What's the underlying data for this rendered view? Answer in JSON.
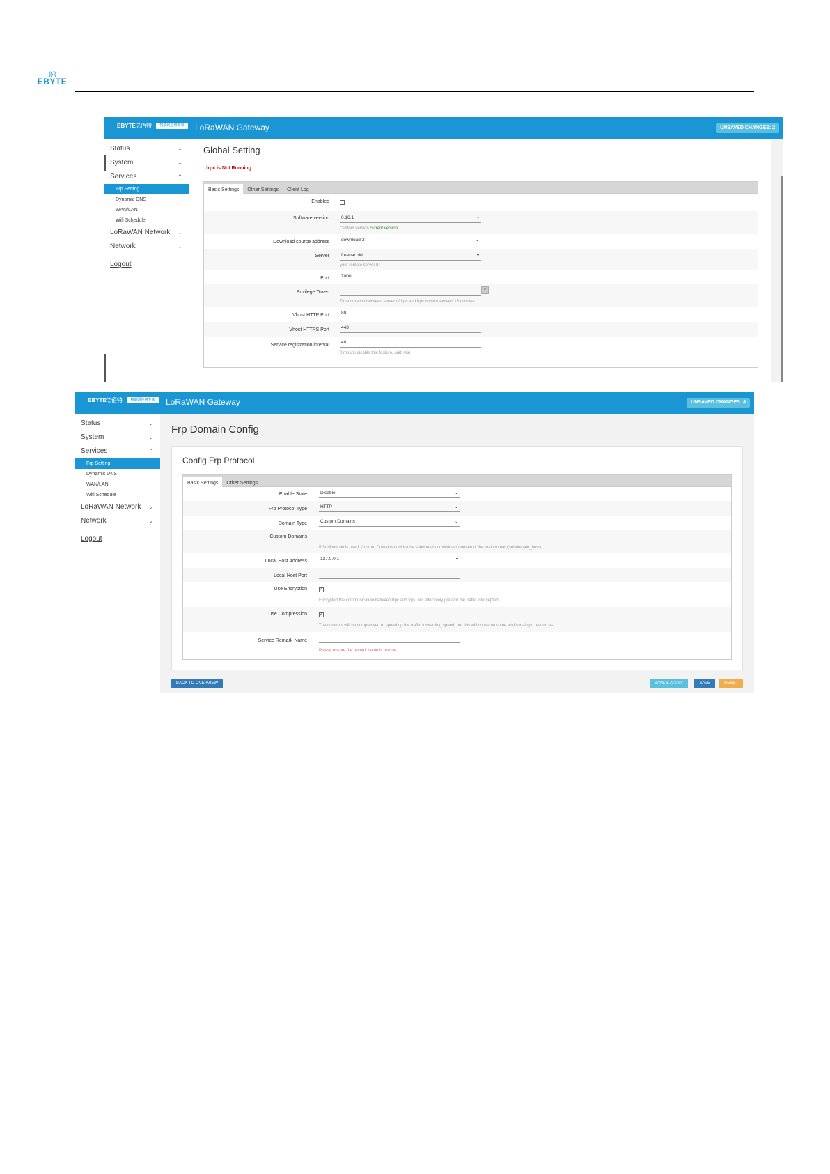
{
  "doc": {
    "logo_text": "EBYTE"
  },
  "shot1": {
    "brand": {
      "logo_text": "EBYTE",
      "logo_cn": "亿佰特",
      "logo_tag": "物联网应用专家"
    },
    "app_title": "LoRaWAN Gateway",
    "unsaved": "UNSAVED CHANGES: 2",
    "nav": {
      "status": "Status",
      "system": "System",
      "services": "Services",
      "lorawan": "LoRaWAN Network",
      "network": "Network",
      "logout": "Logout"
    },
    "subnav": [
      "Frp Setting",
      "Dynamic DNS",
      "WAN/LAN",
      "Wifi Schedule"
    ],
    "page_title": "Global Setting",
    "status_text": "frpc is Not Running",
    "tabs": [
      "Basic Settings",
      "Other Settings",
      "Client Log"
    ],
    "form": {
      "enabled_label": "Enabled",
      "software_version_label": "Software version",
      "software_version_value": "0.16.1",
      "software_version_hint": "Custom version.",
      "software_version_hint_green": "current version:",
      "download_label": "Download source address",
      "download_value": "download-2",
      "server_label": "Server",
      "server_value": "freenat.bid",
      "server_hint": "your remote server IP",
      "port_label": "Port",
      "port_value": "7000",
      "token_label": "Privilege Token",
      "token_value": "········",
      "token_hint": "Time duration between server of frpc and frps mustn't exceed 15 minutes.",
      "vhost_http_label": "Vhost HTTP Port",
      "vhost_http_value": "80",
      "vhost_https_label": "Vhost HTTPS Port",
      "vhost_https_value": "443",
      "reg_label": "Service registration interval",
      "reg_value": "40",
      "reg_hint": "0 means disable this feature, unit: min"
    }
  },
  "shot2": {
    "brand": {
      "logo_text": "EBYTE",
      "logo_cn": "亿佰特",
      "logo_tag": "物联网应用专家"
    },
    "app_title": "LoRaWAN Gateway",
    "unsaved": "UNSAVED CHANGES: 4",
    "nav": {
      "status": "Status",
      "system": "System",
      "services": "Services",
      "lorawan": "LoRaWAN Network",
      "network": "Network",
      "logout": "Logout"
    },
    "subnav": [
      "Frp Setting",
      "Dynamic DNS",
      "WAN/LAN",
      "Wifi Schedule"
    ],
    "page_title": "Frp Domain Config",
    "section_title": "Config Frp Protocol",
    "tabs": [
      "Basic Settings",
      "Other Settings"
    ],
    "form": {
      "enable_state_label": "Enable State",
      "enable_state_value": "Disable",
      "protocol_label": "Frp Protocol Type",
      "protocol_value": "HTTP",
      "domain_type_label": "Domain Type",
      "domain_type_value": "Custom Domains",
      "custom_domains_label": "Custom Domains",
      "custom_domains_hint": "If SubDomain is used, Custom Domains couldn't be subdomain or wildcard domain of the maindomain(subdomain_host).",
      "local_host_label": "Local Host Address",
      "local_host_value": "127.0.0.1",
      "local_port_label": "Local Host Port",
      "encryption_label": "Use Encryption",
      "encryption_hint": "Encrypted the communication between frpc and frps, will effectively prevent the traffic intercepted.",
      "compression_label": "Use Compression",
      "compression_hint": "The contents will be compressed to speed up the traffic forwarding speed, but this will consume some additional cpu resources.",
      "remark_label": "Service Remark Name",
      "remark_hint": "Please ensure the remark name is unique."
    },
    "buttons": {
      "back": "BACK TO OVERVIEW",
      "save_apply": "SAVE & APPLY",
      "save": "SAVE",
      "reset": "RESET"
    }
  },
  "colors": {
    "brand_blue": "#1a96d4",
    "badge_cyan": "#5bc0de",
    "error_red": "#cc0000",
    "save_blue": "#337ab7",
    "reset_orange": "#f0ad4e"
  },
  "icons": [
    "wifi-logo-icon",
    "chevron-down-icon",
    "chevron-up-icon",
    "eye-icon",
    "checkbox-icon"
  ]
}
